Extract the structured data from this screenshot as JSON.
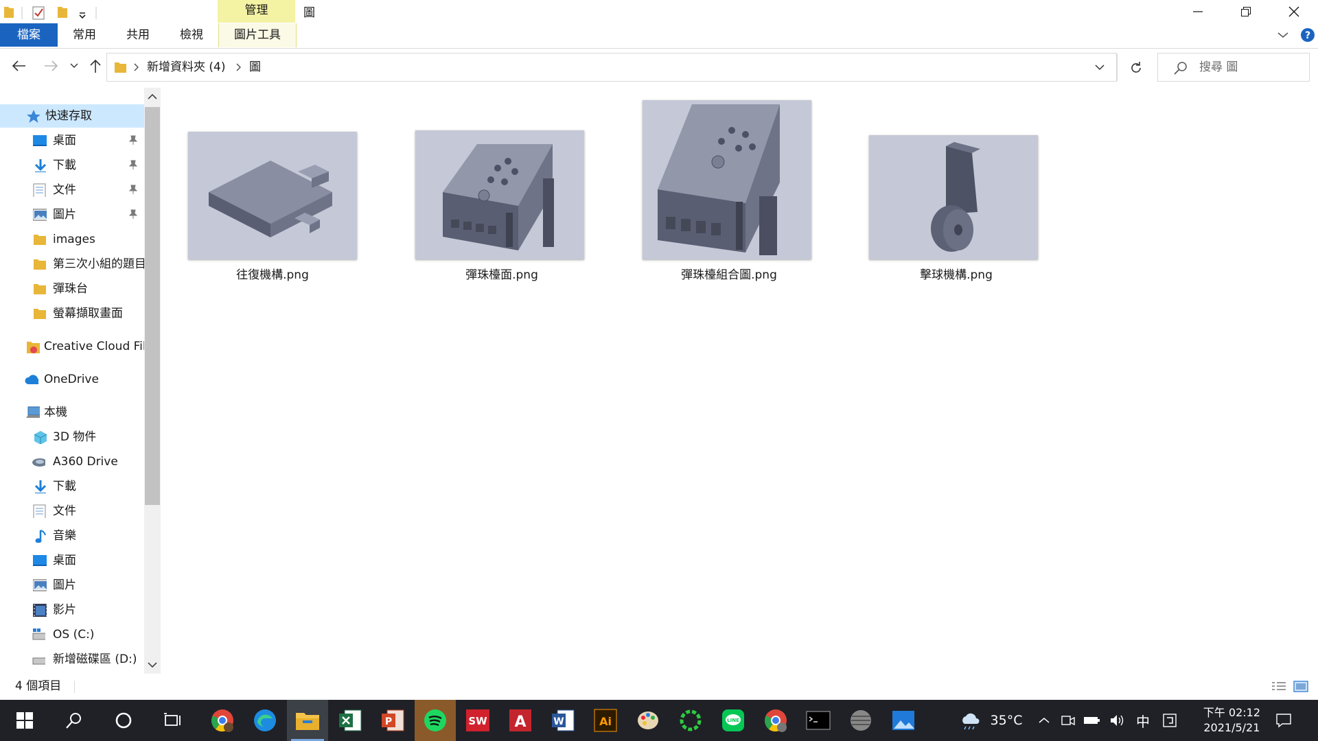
{
  "window": {
    "context_tab": "管理",
    "context_title": "圖"
  },
  "ribbon": {
    "tabs": [
      "檔案",
      "常用",
      "共用",
      "檢視",
      "圖片工具"
    ]
  },
  "address": {
    "crumbs": [
      "新增資料夾 (4)",
      "圖"
    ],
    "search_placeholder": "搜尋 圖"
  },
  "nav": {
    "quick_access": "快速存取",
    "items": [
      {
        "label": "桌面",
        "icon": "desktop-icon",
        "pinned": true
      },
      {
        "label": "下載",
        "icon": "download-icon",
        "pinned": true
      },
      {
        "label": "文件",
        "icon": "document-icon",
        "pinned": true
      },
      {
        "label": "圖片",
        "icon": "pictures-icon",
        "pinned": true
      },
      {
        "label": "images",
        "icon": "folder-icon",
        "pinned": false
      },
      {
        "label": "第三次小組的題目",
        "icon": "folder-icon",
        "pinned": false
      },
      {
        "label": "彈珠台",
        "icon": "folder-icon",
        "pinned": false
      },
      {
        "label": "螢幕擷取畫面",
        "icon": "folder-icon",
        "pinned": false
      }
    ],
    "creative_cloud": "Creative Cloud Files",
    "onedrive": "OneDrive",
    "this_pc": "本機",
    "pc_items": [
      {
        "label": "3D 物件",
        "icon": "3d-objects-icon"
      },
      {
        "label": "A360 Drive",
        "icon": "a360-drive-icon"
      },
      {
        "label": "下載",
        "icon": "download-icon"
      },
      {
        "label": "文件",
        "icon": "document-icon"
      },
      {
        "label": "音樂",
        "icon": "music-icon"
      },
      {
        "label": "桌面",
        "icon": "desktop-icon"
      },
      {
        "label": "圖片",
        "icon": "pictures-icon"
      },
      {
        "label": "影片",
        "icon": "videos-icon"
      },
      {
        "label": "OS (C:)",
        "icon": "drive-c-icon"
      },
      {
        "label": "新增磁碟區 (D:)",
        "icon": "drive-d-icon"
      }
    ]
  },
  "files": [
    {
      "name": "往復機構.png",
      "depicts": "block-cad-icon"
    },
    {
      "name": "彈珠檯面.png",
      "depicts": "pinball-table-cad-icon"
    },
    {
      "name": "彈珠檯組合圖.png",
      "depicts": "pinball-assembly-cad-icon"
    },
    {
      "name": "擊球機構.png",
      "depicts": "striker-cad-icon"
    }
  ],
  "status": {
    "item_count": "4 個項目"
  },
  "taskbar": {
    "weather": "35°C",
    "ime": "中",
    "time": "下午 02:12",
    "date": "2021/5/21",
    "apps": [
      "chrome",
      "edge",
      "file-explorer",
      "excel",
      "powerpoint",
      "spotify",
      "solidworks",
      "autocad",
      "word",
      "illustrator",
      "paint",
      "circular-app",
      "line",
      "chrome-profile",
      "terminal",
      "sphere-app",
      "photos"
    ]
  },
  "colors": {
    "accent": "#1a64c0",
    "context_tab": "#f4f2a3",
    "selection": "#cce8ff",
    "taskbar": "#1f2127",
    "thumb_bg": "#c5c8d6"
  }
}
